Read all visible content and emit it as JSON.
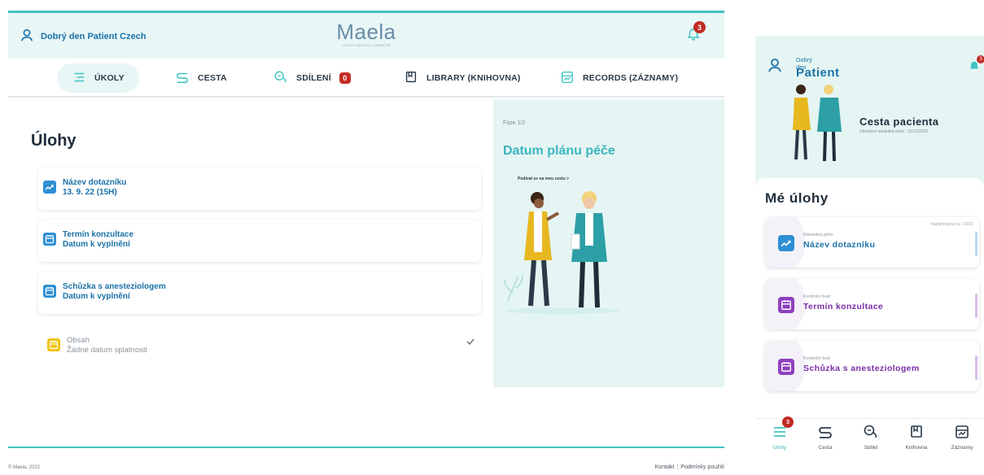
{
  "header": {
    "greeting": "Dobrý den Patient Czech",
    "logo": "Maela",
    "logo_tagline": "LA SUIVI MÉDICAL CONNECTÉ",
    "notification_count": "3"
  },
  "nav": {
    "items": [
      {
        "label": "ÚKOLY",
        "icon": "list-icon",
        "active": true
      },
      {
        "label": "CESTA",
        "icon": "path-icon"
      },
      {
        "label": "SDÍLENÍ",
        "icon": "chat-icon",
        "badge": "0"
      },
      {
        "label": "LIBRARY (KNIHOVNA)",
        "icon": "book-icon"
      },
      {
        "label": "RECORDS (ZÁZNAMY)",
        "icon": "records-icon"
      }
    ]
  },
  "main": {
    "title": "Úlohy",
    "tasks": [
      {
        "title": "Název dotazníku",
        "subtitle": "13. 9. 22 (15H)",
        "icon": "chart-icon",
        "color": "#2d8fd5"
      },
      {
        "title": "Termín konzultace",
        "subtitle": "Datum k vyplnění",
        "icon": "calendar-icon",
        "color": "#2d8fd5"
      },
      {
        "title": "Schůzka s anesteziologem",
        "subtitle": "Datum k vyplnění",
        "icon": "calendar-icon",
        "color": "#2d8fd5"
      }
    ],
    "completed": {
      "title": "Obsah",
      "subtitle": "Žádné datum splatnosti",
      "icon": "calendar-icon",
      "color": "#f1c40f"
    }
  },
  "side": {
    "phase": "Fáze 1/2",
    "title": "Datum plánu péče",
    "link": "Podívat se na mou cestu >"
  },
  "footer": {
    "copyright": "© Maela, 2022",
    "contact": "Kontakt",
    "terms": "Podmínky použití"
  },
  "mobile": {
    "greeting": "Dobrý den",
    "name": "Patient",
    "notification_count": "3",
    "journey_title": "Cesta pacienta",
    "journey_sub": "Ukončení následné péče : 21/12/2022",
    "tasks_title": "Mé úlohy",
    "tasks": [
      {
        "category": "Následná péče",
        "name": "Název dotazníku",
        "due": "Naplánováno na: 13/09",
        "color": "#2d8fd5",
        "name_color": "#1b72a8",
        "bar": "#b9d9ee"
      },
      {
        "category": "Kontrolní bod",
        "name": "Termín konzultace",
        "due": "",
        "color": "#8e3fbf",
        "name_color": "#7a2da8",
        "bar": "#d8bde8"
      },
      {
        "category": "Kontrolní bod",
        "name": "Schůzka s anesteziologem",
        "due": "",
        "color": "#8e3fbf",
        "name_color": "#7a2da8",
        "bar": "#d8bde8"
      }
    ],
    "tabs": [
      {
        "label": "Úlohy",
        "icon": "list-icon",
        "active": true,
        "badge": "3"
      },
      {
        "label": "Cesta",
        "icon": "path-icon"
      },
      {
        "label": "Sdílet",
        "icon": "chat-icon"
      },
      {
        "label": "Knihovna",
        "icon": "book-icon"
      },
      {
        "label": "Záznamy",
        "icon": "records-icon"
      }
    ]
  }
}
